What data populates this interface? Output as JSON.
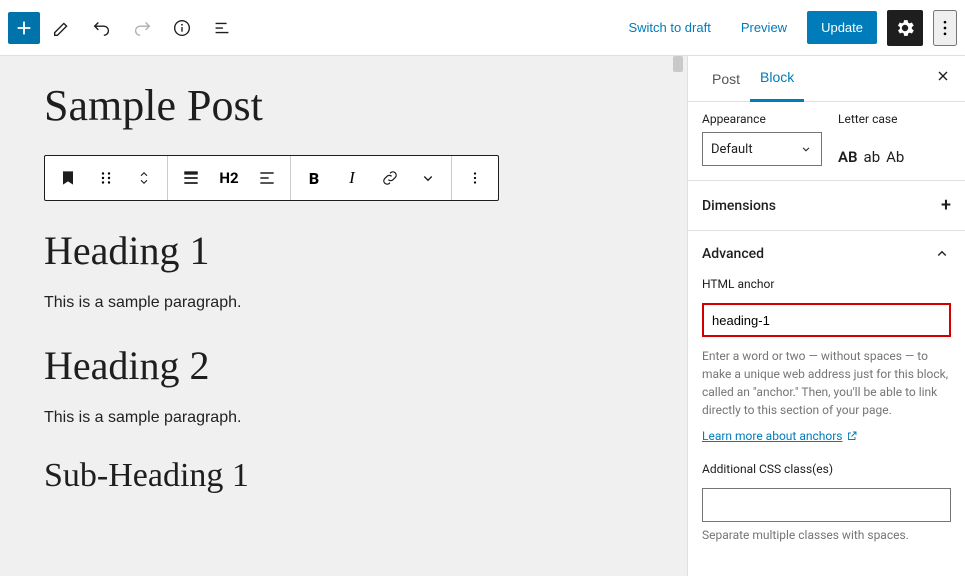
{
  "topbar": {
    "switch_draft": "Switch to draft",
    "preview": "Preview",
    "update": "Update"
  },
  "content": {
    "post_title": "Sample Post",
    "toolbar_heading_level": "H2",
    "heading1": "Heading 1",
    "para1": "This is a sample paragraph.",
    "heading2": "Heading 2",
    "para2": "This is a sample paragraph.",
    "sub1": "Sub-Heading 1"
  },
  "sidebar": {
    "tabs": {
      "post": "Post",
      "block": "Block"
    },
    "appearance": {
      "label": "Appearance",
      "value": "Default",
      "lettercase_label": "Letter case",
      "lc_upper": "AB",
      "lc_lower": "ab",
      "lc_cap": "Ab"
    },
    "dimensions_label": "Dimensions",
    "advanced": {
      "label": "Advanced",
      "anchor_label": "HTML anchor",
      "anchor_value": "heading-1",
      "anchor_help": "Enter a word or two — without spaces — to make a unique web address just for this block, called an \"anchor.\" Then, you'll be able to link directly to this section of your page.",
      "learn_link": "Learn more about anchors",
      "css_label": "Additional CSS class(es)",
      "css_help": "Separate multiple classes with spaces."
    }
  }
}
